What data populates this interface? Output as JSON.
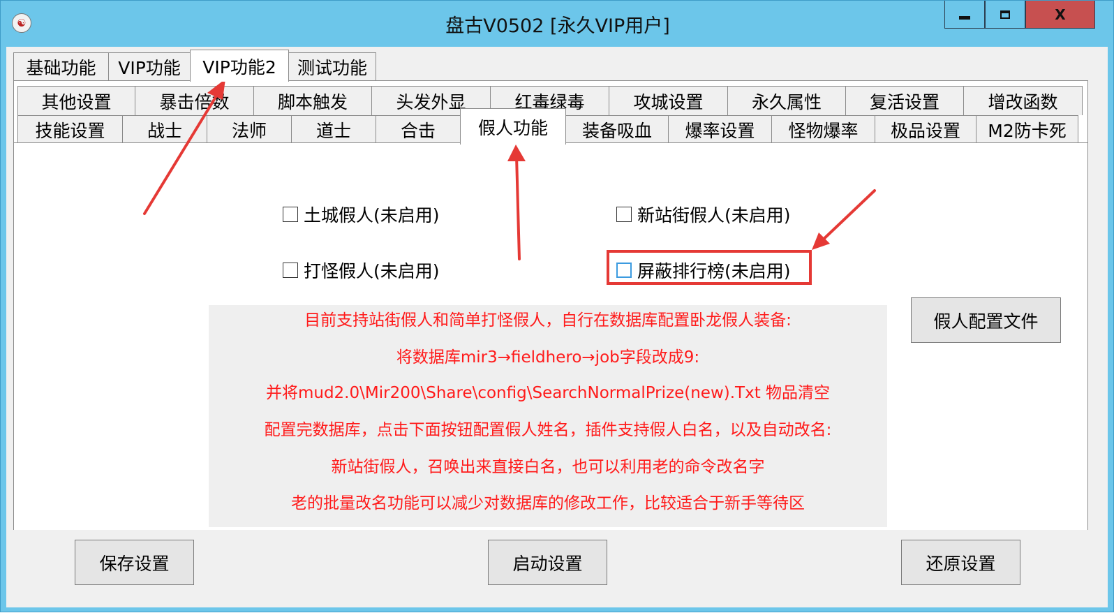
{
  "window": {
    "title": "盘古V0502 [永久VIP用户]",
    "icon": "app-logo-icon",
    "buttons": {
      "minimize": "minimize-icon",
      "maximize": "maximize-icon",
      "close_label": "X"
    }
  },
  "main_tabs": [
    {
      "label": "基础功能",
      "active": false
    },
    {
      "label": "VIP功能",
      "active": false
    },
    {
      "label": "VIP功能2",
      "active": true
    },
    {
      "label": "测试功能",
      "active": false
    }
  ],
  "sub_tabs_row1": [
    "其他设置",
    "暴击倍数",
    "脚本触发",
    "头发外显",
    "红毒绿毒",
    "攻城设置",
    "永久属性",
    "复活设置",
    "增改函数"
  ],
  "sub_tabs_row2": [
    "技能设置",
    "战士",
    "法师",
    "道士",
    "合击",
    "假人功能",
    "装备吸血",
    "爆率设置",
    "怪物爆率",
    "极品设置",
    "M2防卡死"
  ],
  "active_sub_tab": "假人功能",
  "options": {
    "city_bot": {
      "label": "土城假人(未启用)",
      "checked": false
    },
    "street_bot": {
      "label": "新站街假人(未启用)",
      "checked": false
    },
    "monster_bot": {
      "label": "打怪假人(未启用)",
      "checked": false
    },
    "hide_ranking": {
      "label": "屏蔽排行榜(未启用)",
      "checked": false
    }
  },
  "info_lines": [
    "目前支持站街假人和简单打怪假人，自行在数据库配置卧龙假人装备:",
    "将数据库mir3→fieldhero→job字段改成9:",
    "并将mud2.0\\Mir200\\Share\\config\\SearchNormalPrize(new).Txt 物品清空",
    "配置完数据库，点击下面按钮配置假人姓名，插件支持假人白名，以及自动改名:",
    "新站街假人，召唤出来直接白名，也可以利用老的命令改名字",
    "老的批量改名功能可以减少对数据库的修改工作，比较适合于新手等待区"
  ],
  "buttons": {
    "bot_config": "假人配置文件",
    "save": "保存设置",
    "start": "启动设置",
    "restore": "还原设置"
  },
  "annotation_color": "#e53935"
}
